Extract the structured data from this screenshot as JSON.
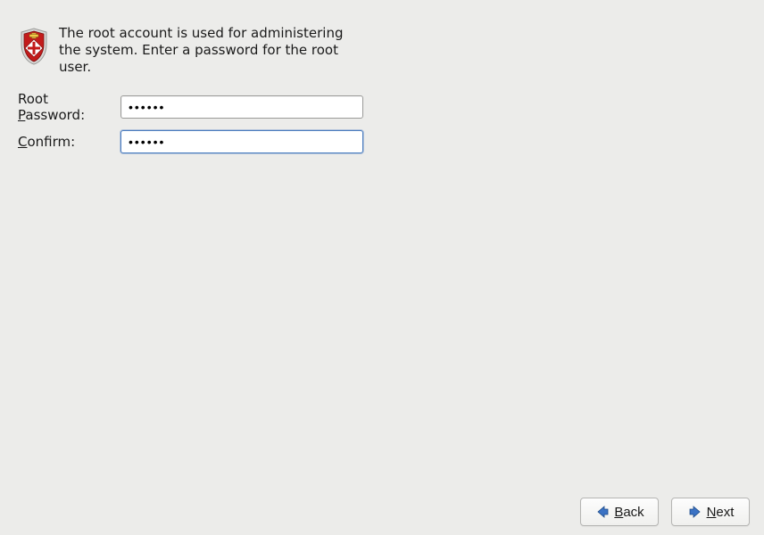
{
  "icon": {
    "name": "root-shield-icon"
  },
  "description": "The root account is used for administering the system.  Enter a password for the root user.",
  "fields": {
    "password": {
      "label_pre": "Root ",
      "label_ul": "P",
      "label_post": "assword:",
      "value": "••••••"
    },
    "confirm": {
      "label_pre": "",
      "label_ul": "C",
      "label_post": "onfirm:",
      "value": "••••••"
    }
  },
  "buttons": {
    "back": {
      "ul": "B",
      "rest": "ack"
    },
    "next": {
      "ul": "N",
      "rest": "ext"
    }
  }
}
